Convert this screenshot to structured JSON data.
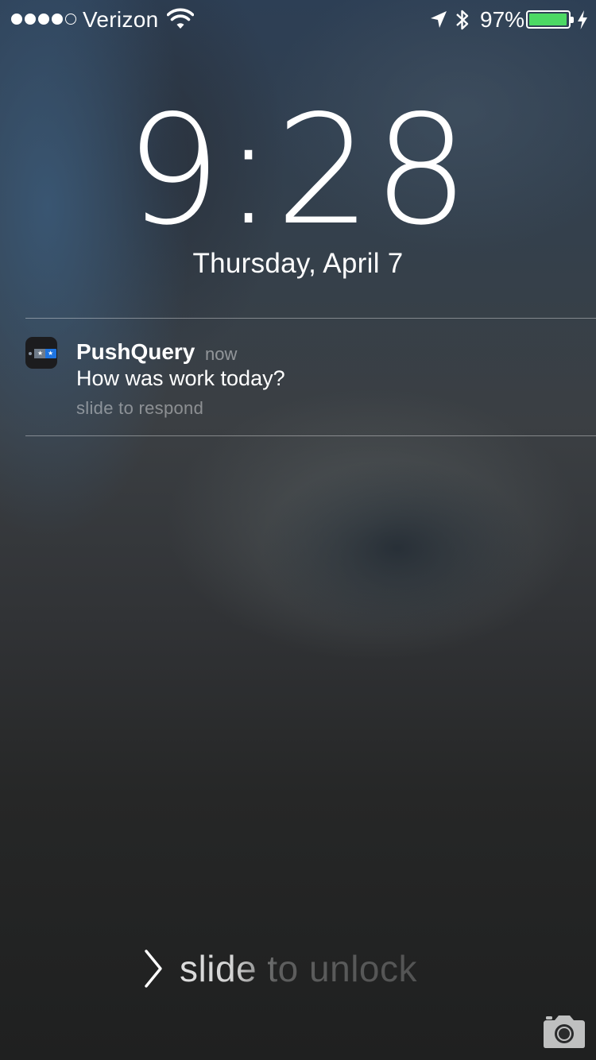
{
  "status_bar": {
    "signal_bars_filled": 4,
    "signal_bars_total": 5,
    "carrier": "Verizon",
    "battery_percent_text": "97%",
    "battery_level": 0.97,
    "charging": true,
    "location_services": true,
    "bluetooth": true,
    "icons": [
      "wifi-icon",
      "location-arrow-icon",
      "bluetooth-icon",
      "battery-icon",
      "charging-bolt-icon"
    ]
  },
  "lock_screen": {
    "time": "9:28",
    "date": "Thursday, April 7"
  },
  "notification": {
    "app_name": "PushQuery",
    "time": "now",
    "message": "How was work today?",
    "hint": "slide to respond",
    "icon": "pushquery-app-icon"
  },
  "unlock": {
    "label": "slide to unlock",
    "icon": "chevron-right-icon"
  },
  "camera": {
    "icon": "camera-icon"
  },
  "colors": {
    "battery_fill": "#4cd964",
    "app_icon_blue": "#1e74e0",
    "app_icon_bg": "#1c1c1e"
  }
}
